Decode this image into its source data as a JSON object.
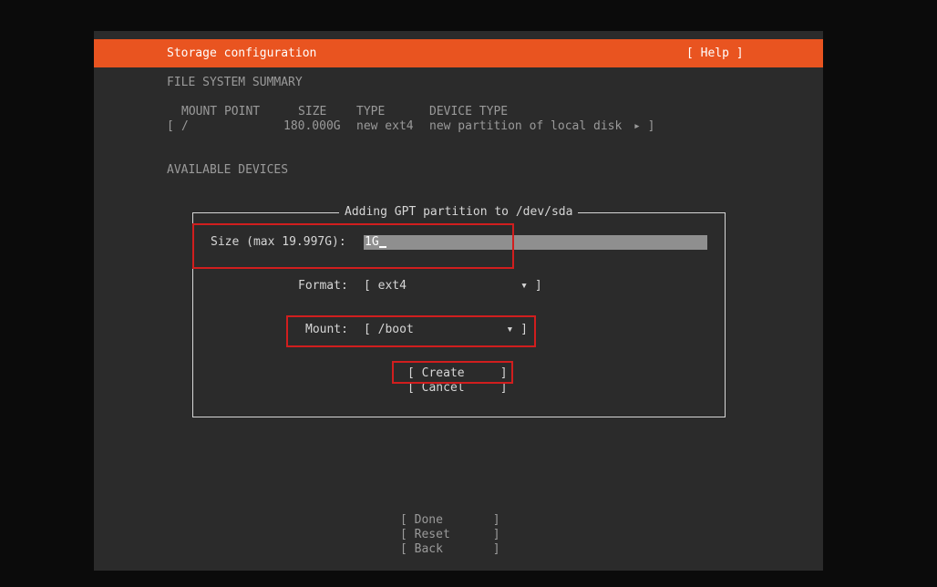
{
  "header": {
    "title": "Storage configuration",
    "help_label": "[ Help ]"
  },
  "summary": {
    "heading": "FILE SYSTEM SUMMARY",
    "columns": [
      "MOUNT POINT",
      "SIZE",
      "TYPE",
      "DEVICE TYPE"
    ],
    "row": {
      "open_bracket": "[",
      "mount": "/",
      "size": "180.000G",
      "type": "new ext4",
      "device": "new partition of local disk",
      "arrow": "▸ ]"
    }
  },
  "available": {
    "heading": "AVAILABLE DEVICES"
  },
  "dialog": {
    "title": "Adding GPT partition to /dev/sda",
    "size_label": "Size (max 19.997G):",
    "size_value": "1G",
    "format_label": "Format:",
    "format_value": "[ ext4                ▾ ]",
    "mount_label": "Mount:",
    "mount_value": "[ /boot             ▾ ]",
    "create_label": "[ Create     ]",
    "cancel_label": "[ Cancel     ]"
  },
  "footer": {
    "done_label": "[ Done       ]",
    "reset_label": "[ Reset      ]",
    "back_label": "[ Back       ]"
  },
  "colors": {
    "accent": "#e95420",
    "highlight": "#d11e1e",
    "background": "#2b2b2b"
  }
}
